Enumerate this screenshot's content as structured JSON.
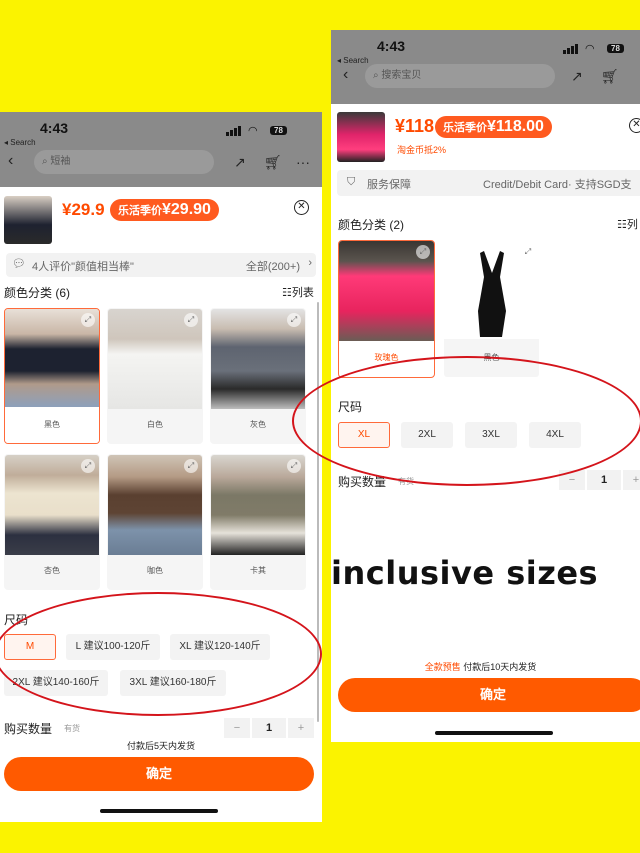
{
  "left": {
    "status": {
      "time": "4:43",
      "back_label": "Search",
      "battery": "78"
    },
    "search_placeholder": "短袖",
    "product": {
      "price": "¥29.9",
      "promo_label": "乐活季价",
      "promo_price": "¥29.90"
    },
    "reviews": {
      "text": "4人评价\"颜值相当棒\"",
      "all": "全部(200+)"
    },
    "color_section": {
      "title": "颜色分类 (6)",
      "view_toggle": "列表"
    },
    "colors": [
      {
        "label": "黑色",
        "selected": true
      },
      {
        "label": "白色",
        "selected": false
      },
      {
        "label": "灰色",
        "selected": false
      },
      {
        "label": "杏色",
        "selected": false
      },
      {
        "label": "咖色",
        "selected": false
      },
      {
        "label": "卡其",
        "selected": false
      }
    ],
    "size_section": {
      "title": "尺码"
    },
    "sizes": [
      {
        "label": "M",
        "selected": true
      },
      {
        "label": "L 建议100-120斤",
        "selected": false
      },
      {
        "label": "XL 建议120-140斤",
        "selected": false
      },
      {
        "label": "2XL 建议140-160斤",
        "selected": false
      },
      {
        "label": "3XL 建议160-180斤",
        "selected": false
      }
    ],
    "quantity": {
      "label": "购买数量",
      "stock": "有货",
      "minus": "−",
      "value": "1",
      "plus": "+"
    },
    "ship_note": "付款后5天内发货",
    "confirm": "确定"
  },
  "right": {
    "status": {
      "time": "4:43",
      "back_label": "Search",
      "battery": "78"
    },
    "search_placeholder": "搜索宝贝",
    "product": {
      "price": "¥118",
      "promo_label": "乐活季价",
      "promo_price": "¥118.00",
      "coin_note": "淘金币抵2%"
    },
    "service": {
      "label": "服务保障",
      "value": "Credit/Debit Card· 支持SGD支"
    },
    "color_section": {
      "title": "颜色分类 (2)",
      "view_toggle": "列"
    },
    "colors": [
      {
        "label": "玫瑰色",
        "selected": true
      },
      {
        "label": "黑色",
        "selected": false
      }
    ],
    "size_section": {
      "title": "尺码"
    },
    "sizes": [
      {
        "label": "XL",
        "selected": true
      },
      {
        "label": "2XL",
        "selected": false
      },
      {
        "label": "3XL",
        "selected": false
      },
      {
        "label": "4XL",
        "selected": false
      }
    ],
    "quantity": {
      "label": "购买数量",
      "stock": "有货",
      "minus": "−",
      "value": "1",
      "plus": "+"
    },
    "ship_note_pre": "全款预售",
    "ship_note": "付款后10天内发货",
    "confirm": "确定"
  },
  "caption": "inclusive sizes",
  "colors": {
    "background": "#fbf300",
    "accent": "#ff5a00",
    "circle": "#d4141b"
  },
  "icons": [
    "chevron-left-icon",
    "share-icon",
    "cart-icon",
    "more-icon",
    "close-icon",
    "chat-icon",
    "chevron-right-icon",
    "shield-icon",
    "list-view-icon",
    "zoom-icon"
  ]
}
